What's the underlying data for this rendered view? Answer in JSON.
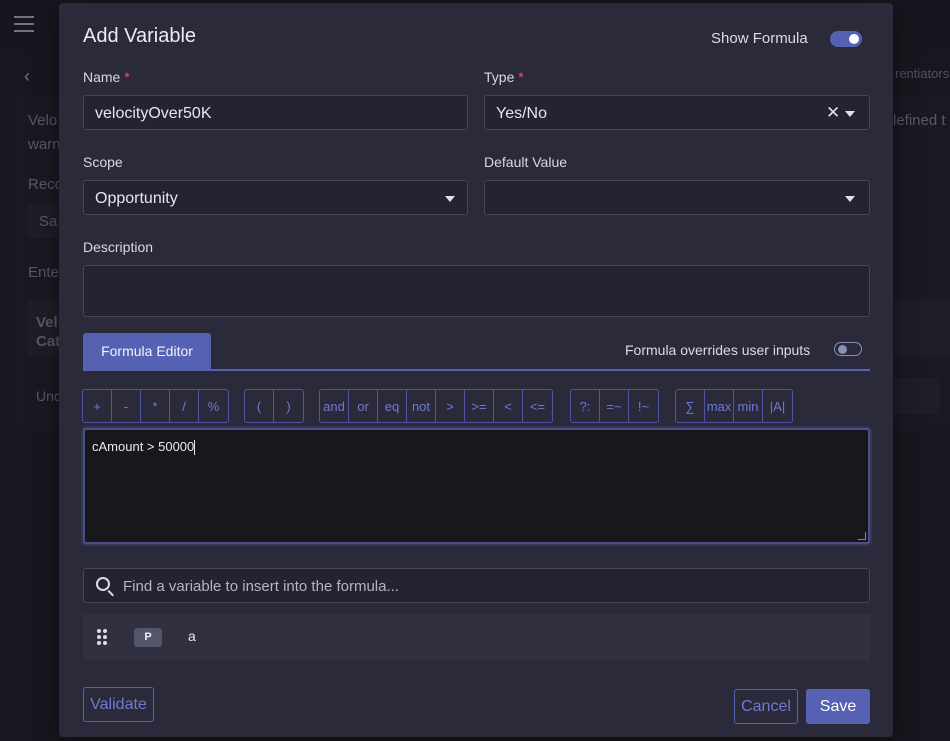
{
  "background": {
    "tab_partial": "rentiators",
    "texts": [
      "Velo",
      "warn",
      "Reco",
      "Sa",
      "Ente",
      "Vel",
      "Cat",
      "Unc",
      "lefined t"
    ]
  },
  "modal": {
    "title": "Add Variable",
    "show_formula_label": "Show Formula",
    "show_formula_on": true,
    "name": {
      "label": "Name",
      "required_mark": "*",
      "value": "velocityOver50K"
    },
    "type": {
      "label": "Type",
      "required_mark": "*",
      "value": "Yes/No",
      "clear": "✕"
    },
    "scope": {
      "label": "Scope",
      "value": "Opportunity"
    },
    "default_value": {
      "label": "Default Value",
      "value": ""
    },
    "description": {
      "label": "Description",
      "value": ""
    },
    "formula_tab": "Formula Editor",
    "override_label": "Formula overrides user inputs",
    "override_on": false,
    "operator_groups": [
      [
        "+",
        "-",
        "*",
        "/",
        "%"
      ],
      [
        "(",
        ")"
      ],
      [
        "and",
        "or",
        "eq",
        "not",
        ">",
        ">=",
        "<",
        "<="
      ],
      [
        "?:",
        "=~",
        "!~"
      ],
      [
        "∑",
        "max",
        "min",
        "|A|"
      ]
    ],
    "formula": "cAmount > 50000",
    "search_placeholder": "Find a variable to insert into the formula...",
    "variable_row": {
      "badge": "P",
      "name": "a"
    },
    "validate_label": "Validate",
    "cancel_label": "Cancel",
    "save_label": "Save"
  },
  "colors": {
    "accent": "#5661b3",
    "modal_bg": "#2a2a3a",
    "required": "#e05a6a"
  }
}
